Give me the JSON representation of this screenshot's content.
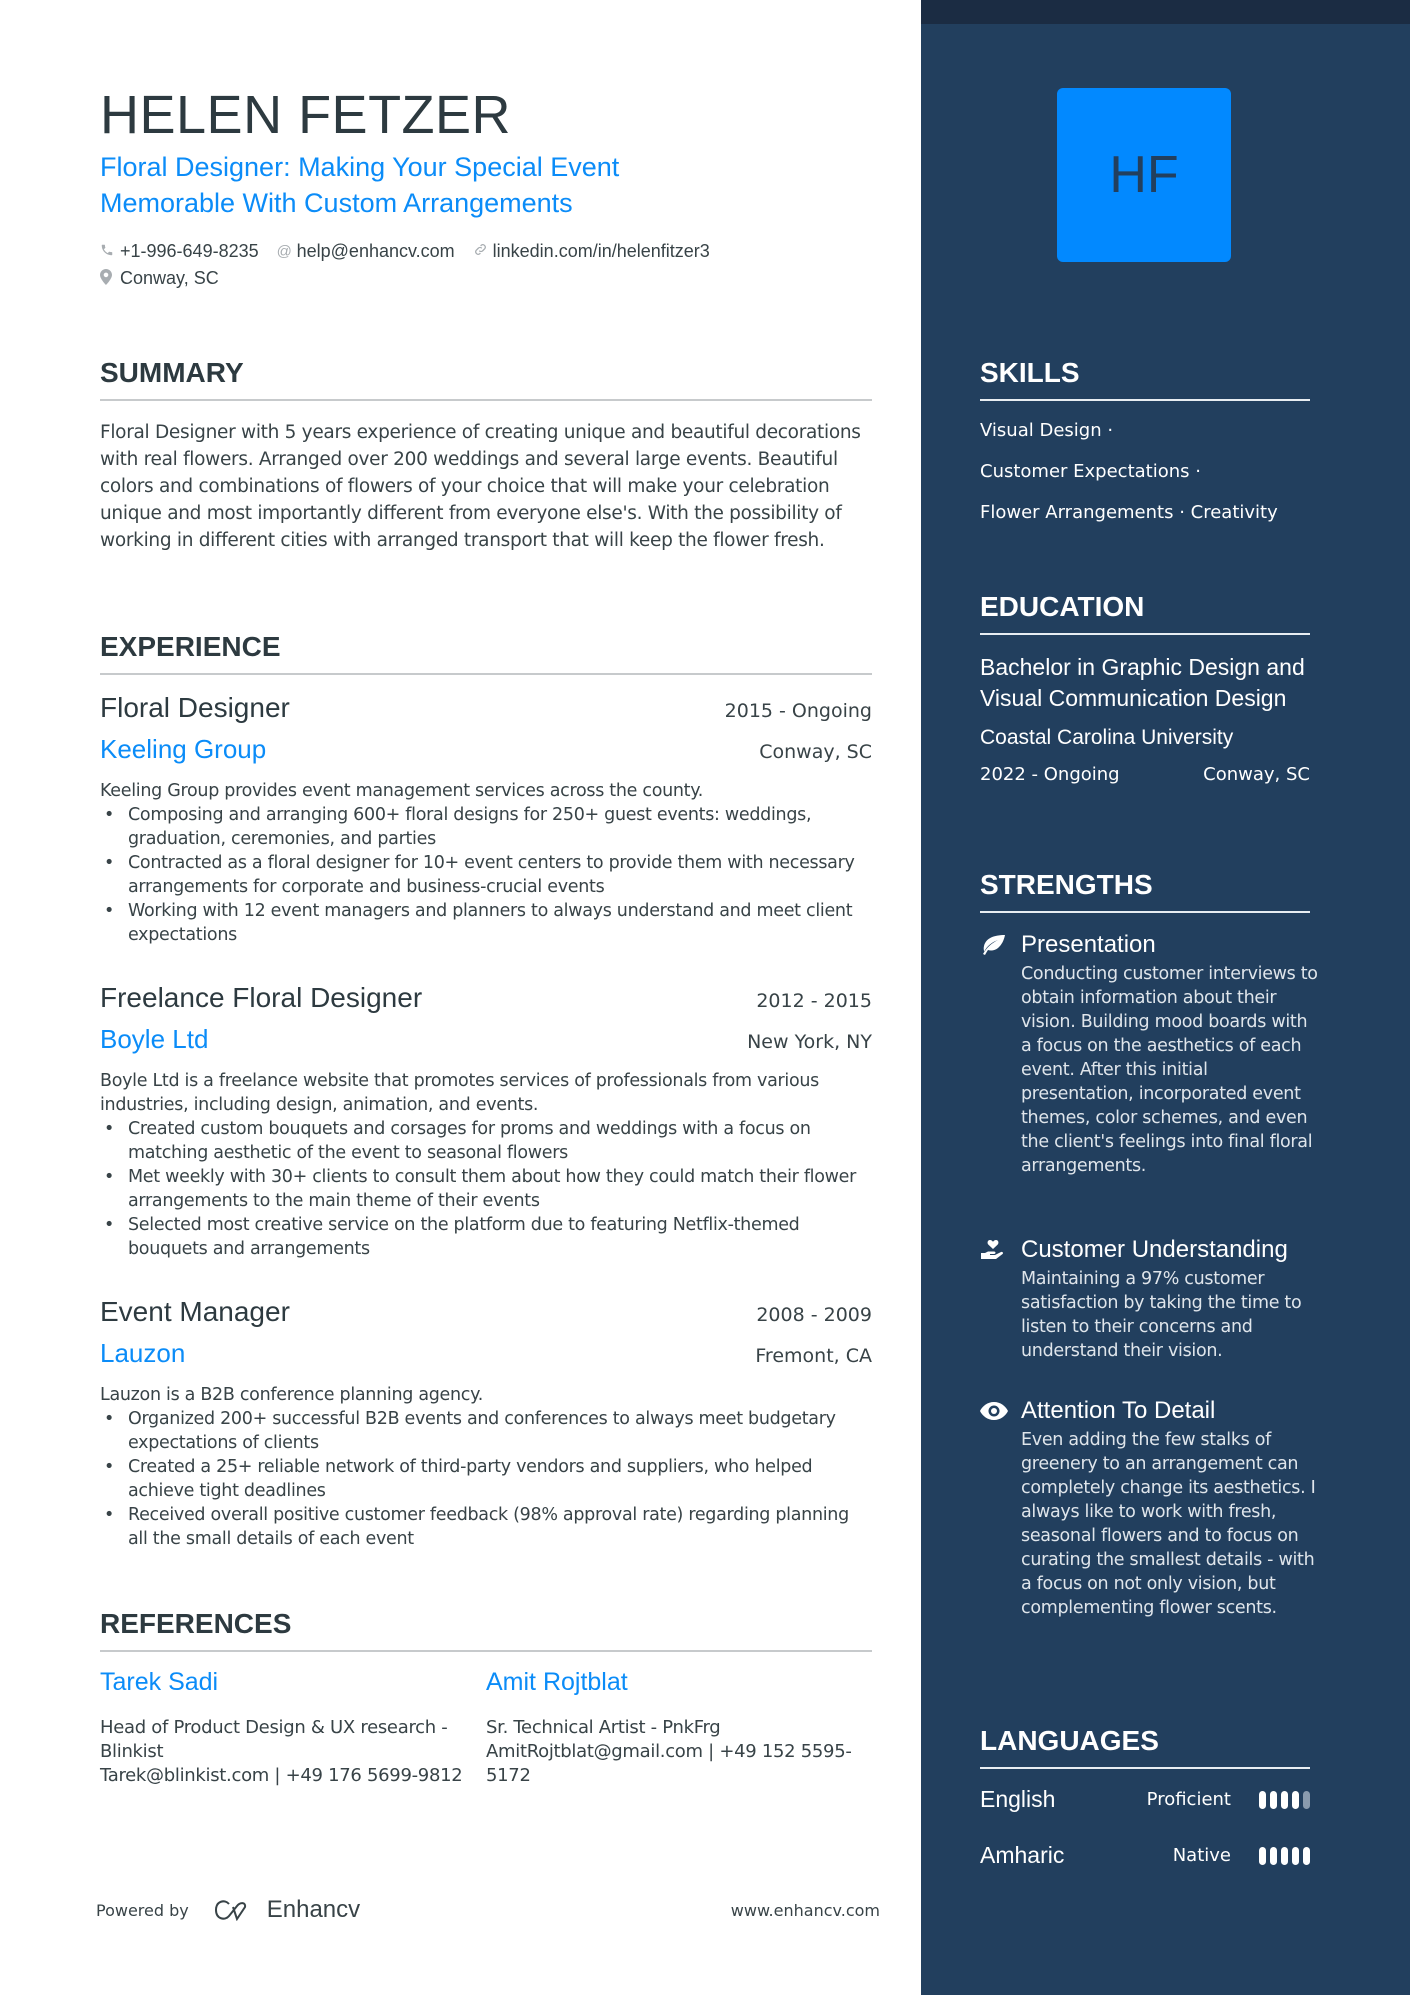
{
  "header": {
    "name": "HELEN FETZER",
    "headline": "Floral Designer: Making Your Special Event Memorable With Custom Arrangements",
    "contacts": {
      "phone": "+1-996-649-8235",
      "email": "help@enhancv.com",
      "linkedin": "linkedin.com/in/helenfitzer3",
      "location": "Conway, SC"
    }
  },
  "summary": {
    "title": "SUMMARY",
    "text": "Floral Designer with 5 years experience of creating unique and beautiful decorations with real flowers. Arranged over 200 weddings and several large events. Beautiful colors and combinations of flowers of your choice that will make your celebration unique and most importantly different from everyone else's. With the possibility of working in different cities with arranged transport that will keep the flower fresh."
  },
  "experience": {
    "title": "EXPERIENCE",
    "items": [
      {
        "title": "Floral Designer",
        "dates": "2015 - Ongoing",
        "company": "Keeling Group",
        "location": "Conway, SC",
        "description": "Keeling Group provides event management services across the county.",
        "bullets": [
          "Composing and arranging 600+ floral designs for 250+ guest events: weddings, graduation, ceremonies, and parties",
          "Contracted as a floral designer for 10+ event centers to provide them with necessary arrangements for corporate and business-crucial events",
          "Working with 12 event managers and planners to always understand and meet client expectations"
        ]
      },
      {
        "title": "Freelance Floral Designer",
        "dates": "2012 - 2015",
        "company": "Boyle Ltd",
        "location": "New York, NY",
        "description": "Boyle Ltd is a freelance website that promotes services of professionals from various industries, including design, animation, and events.",
        "bullets": [
          "Created custom bouquets and corsages for proms and weddings with a focus on matching aesthetic of the event to seasonal flowers",
          "Met weekly with 30+ clients to consult them about how they could match their flower arrangements to the main theme of their events",
          "Selected most creative service on the platform due to featuring Netflix-themed bouquets and arrangements"
        ]
      },
      {
        "title": "Event Manager",
        "dates": "2008 - 2009",
        "company": "Lauzon",
        "location": "Fremont, CA",
        "description": "Lauzon is a B2B conference planning agency.",
        "bullets": [
          "Organized 200+ successful B2B events and conferences to always meet budgetary expectations of clients",
          "Created a 25+ reliable network of third-party vendors and suppliers, who helped achieve tight deadlines",
          "Received overall positive customer feedback (98% approval rate) regarding planning all the small details of each event"
        ]
      }
    ]
  },
  "references": {
    "title": "REFERENCES",
    "items": [
      {
        "name": "Tarek Sadi",
        "role": "Head of Product Design & UX research - Blinkist",
        "contact": "Tarek@blinkist.com | +49 176 5699-9812"
      },
      {
        "name": "Amit Rojtblat",
        "role": "Sr. Technical Artist - PnkFrg",
        "contact": "AmitRojtblat@gmail.com | +49 152 5595-5172"
      }
    ]
  },
  "footer": {
    "powered_by": "Powered by",
    "brand": "Enhancv",
    "website": "www.enhancv.com"
  },
  "sidebar": {
    "initials": "HF",
    "skills": {
      "title": "SKILLS",
      "lines": [
        "Visual Design ·",
        "Customer Expectations ·",
        "Flower Arrangements · Creativity"
      ]
    },
    "education": {
      "title": "EDUCATION",
      "degree": "Bachelor in Graphic Design and Visual Communication Design",
      "school": "Coastal Carolina University",
      "dates": "2022 - Ongoing",
      "location": "Conway, SC"
    },
    "strengths": {
      "title": "STRENGTHS",
      "items": [
        {
          "icon": "leaf-icon",
          "title": "Presentation",
          "description": "Conducting customer interviews to obtain information about their vision. Building mood boards with a focus on the aesthetics of each event. After this initial presentation, incorporated event themes, color schemes, and even the client's feelings into final floral arrangements."
        },
        {
          "icon": "hand-heart-icon",
          "title": "Customer Understanding",
          "description": "Maintaining a 97% customer satisfaction by taking the time to listen to their concerns and understand their vision."
        },
        {
          "icon": "eye-icon",
          "title": "Attention To Detail",
          "description": "Even adding the few stalks of greenery to an arrangement can completely change its aesthetics. I always like to work with fresh, seasonal flowers and to focus on curating the smallest details - with a focus on not only vision, but complementing flower scents."
        }
      ]
    },
    "languages": {
      "title": "LANGUAGES",
      "items": [
        {
          "name": "English",
          "level": "Proficient",
          "rating": 4,
          "max": 5
        },
        {
          "name": "Amharic",
          "level": "Native",
          "rating": 5,
          "max": 5
        }
      ]
    }
  },
  "colors": {
    "accent": "#0b8cf8",
    "sidebar_bg": "#223f5e",
    "sidebar_top": "#1b2c43",
    "avatar_bg": "#0289ff",
    "text": "#384347"
  }
}
